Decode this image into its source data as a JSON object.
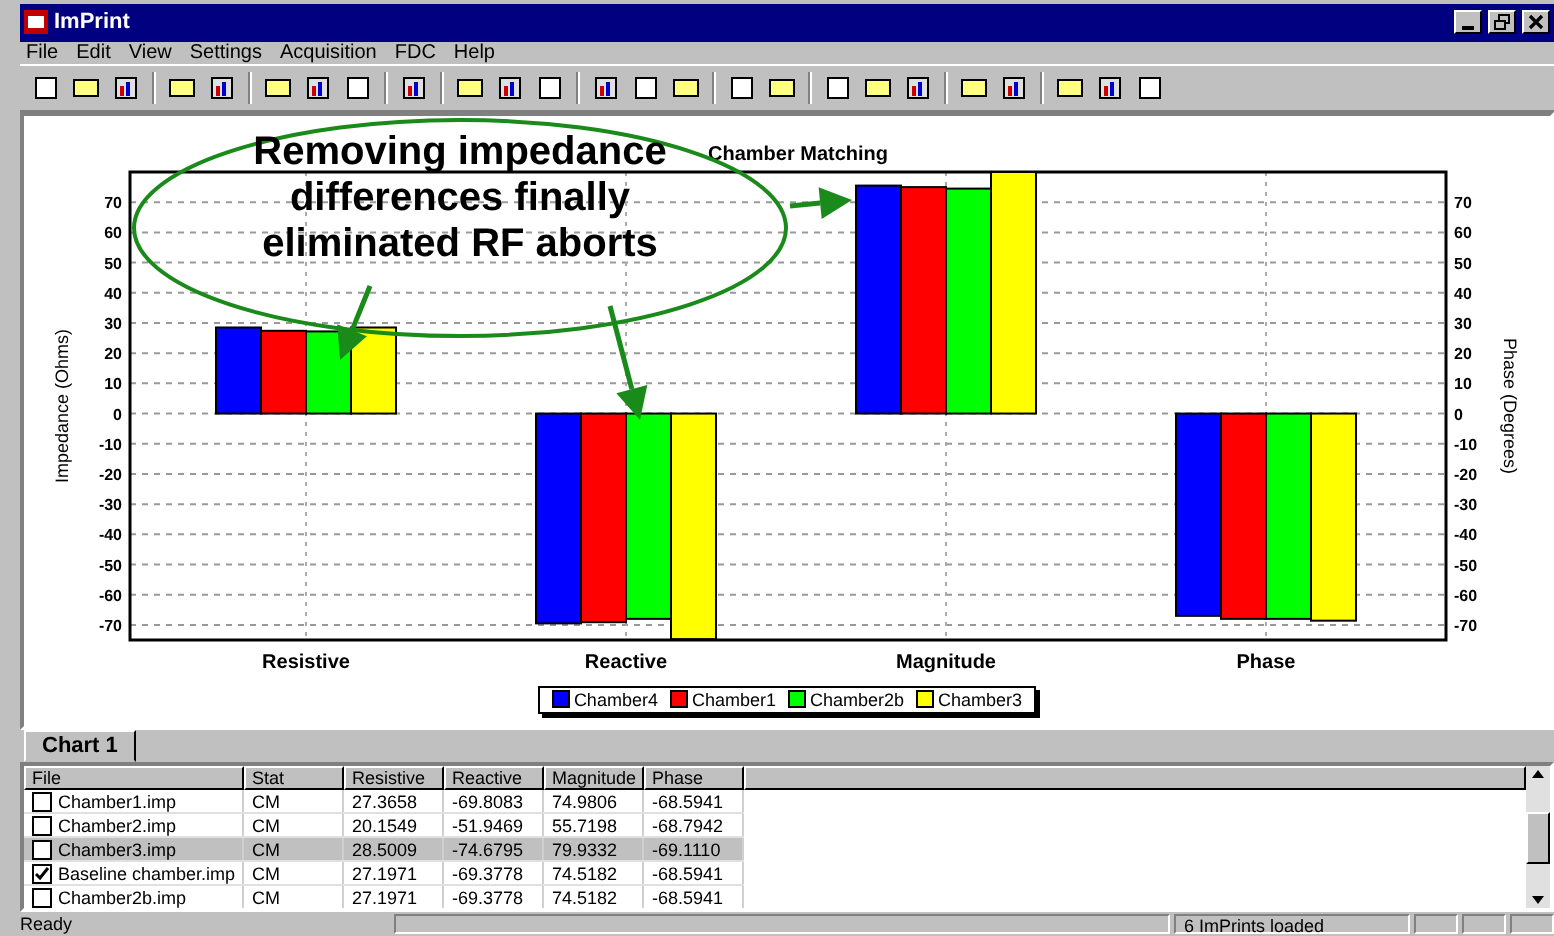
{
  "window": {
    "title": "ImPrint"
  },
  "menu": [
    "File",
    "Edit",
    "View",
    "Settings",
    "Acquisition",
    "FDC",
    "Help"
  ],
  "callout": {
    "lines": [
      "Removing impedance",
      "differences finally",
      "eliminated RF aborts"
    ]
  },
  "chart": {
    "right_axis_label": "Phase (Degrees)",
    "right_axis_ticks": [
      "70",
      "60",
      "50",
      "40",
      "30",
      "20",
      "10",
      "0",
      "-10",
      "-20",
      "-30",
      "-40",
      "-50",
      "-60",
      "-70"
    ],
    "chart_data": {
      "type": "bar",
      "grid": true,
      "title": "Chamber Matching",
      "ylabel": "Impedance (Ohms)",
      "categories": [
        "Resistive",
        "Reactive",
        "Magnitude",
        "Phase"
      ],
      "series": [
        {
          "name": "Chamber4",
          "color": "#0000ff",
          "values": [
            28.5,
            -69.5,
            75.5,
            -67
          ]
        },
        {
          "name": "Chamber1",
          "color": "#ff0000",
          "values": [
            27.4,
            -69.1,
            75,
            -68
          ]
        },
        {
          "name": "Chamber2b",
          "color": "#00ff00",
          "values": [
            27.2,
            -68,
            74.5,
            -68
          ]
        },
        {
          "name": "Chamber3",
          "color": "#ffff00",
          "values": [
            28.5,
            -74.7,
            80,
            -68.6
          ]
        }
      ],
      "ylim": [
        -75,
        80
      ],
      "yticks": [
        -70,
        -60,
        -50,
        -40,
        -30,
        -20,
        -10,
        0,
        10,
        20,
        30,
        40,
        50,
        60,
        70
      ]
    }
  },
  "tabs": [
    {
      "label": "Chart 1",
      "selected": true
    }
  ],
  "table": {
    "columns": [
      "File",
      "Stat",
      "Resistive",
      "Reactive",
      "Magnitude",
      "Phase"
    ],
    "rows": [
      {
        "checked": false,
        "selected": false,
        "cells": [
          "Chamber1.imp",
          "CM",
          "27.3658",
          "-69.8083",
          "74.9806",
          "-68.5941"
        ]
      },
      {
        "checked": false,
        "selected": false,
        "cells": [
          "Chamber2.imp",
          "CM",
          "20.1549",
          "-51.9469",
          "55.7198",
          "-68.7942"
        ]
      },
      {
        "checked": false,
        "selected": true,
        "cells": [
          "Chamber3.imp",
          "CM",
          "28.5009",
          "-74.6795",
          "79.9332",
          "-69.1110"
        ]
      },
      {
        "checked": true,
        "selected": false,
        "cells": [
          "Baseline chamber.imp",
          "CM",
          "27.1971",
          "-69.3778",
          "74.5182",
          "-68.5941"
        ]
      },
      {
        "checked": false,
        "selected": false,
        "cells": [
          "Chamber2b.imp",
          "CM",
          "27.1971",
          "-69.3778",
          "74.5182",
          "-68.5941"
        ]
      }
    ]
  },
  "status_bar": {
    "message": "Ready",
    "count": "6 ImPrints loaded"
  }
}
